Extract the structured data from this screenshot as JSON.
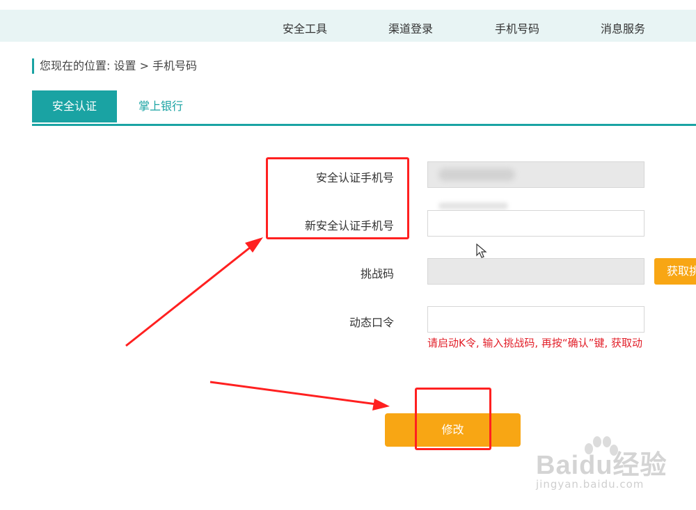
{
  "nav": {
    "items": [
      "安全工具",
      "渠道登录",
      "手机号码",
      "消息服务"
    ]
  },
  "breadcrumb": "您现在的位置: 设置 > 手机号码",
  "tabs": [
    {
      "label": "安全认证",
      "active": true
    },
    {
      "label": "掌上银行",
      "active": false
    }
  ],
  "form": {
    "current_phone_label": "安全认证手机号",
    "new_phone_label": "新安全认证手机号",
    "challenge_label": "挑战码",
    "dynamic_password_label": "动态口令",
    "sms_button_label": "获取挑",
    "hint": "请启动K令, 输入挑战码, 再按“确认”键, 获取动"
  },
  "submit_label": "修改",
  "watermark": {
    "brand": "Baidu经验",
    "url": "jingyan.baidu.com"
  },
  "colors": {
    "accent": "#1aa3a3",
    "orange": "#f8a614",
    "annotation_red": "#ff2020",
    "hint_red": "#e2202a"
  }
}
